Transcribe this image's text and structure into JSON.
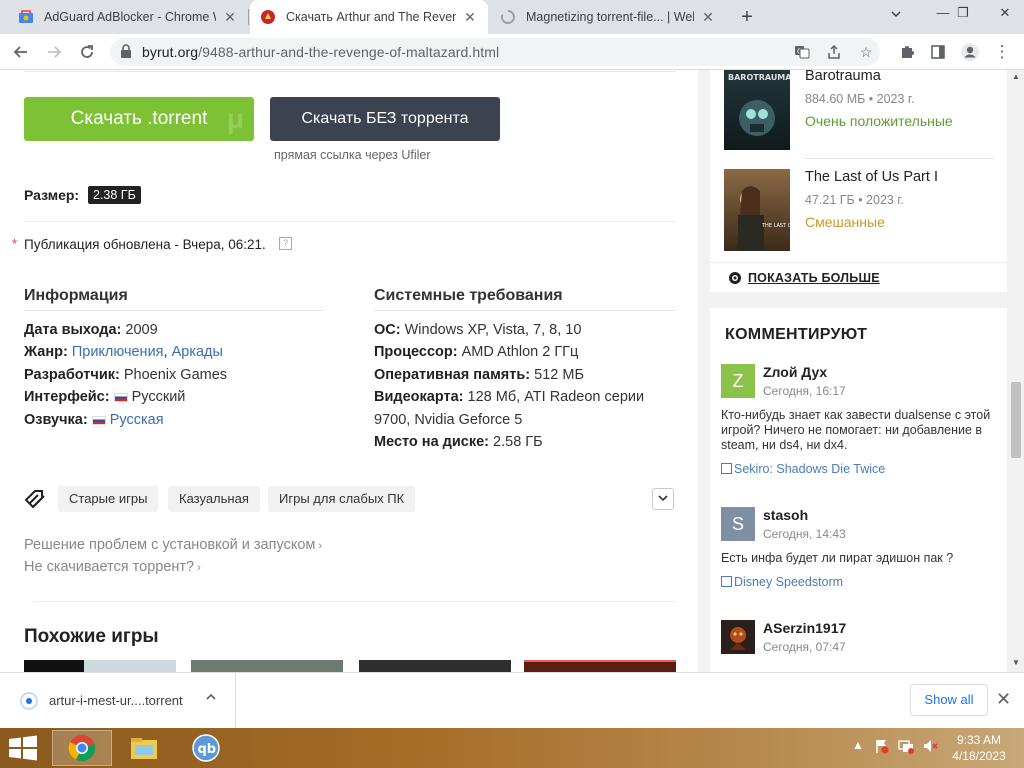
{
  "browser": {
    "tabs": [
      {
        "title": "AdGuard AdBlocker - Chrome Web Store",
        "active": false
      },
      {
        "title": "Скачать Arthur and The Revenge of Maltazard",
        "active": true
      },
      {
        "title": "Magnetizing torrent-file... | Webtor",
        "active": false
      }
    ],
    "url_host": "byrut.org",
    "url_path": "/9488-arthur-and-the-revenge-of-maltazard.html"
  },
  "page": {
    "download_torrent_label": "Скачать .torrent",
    "download_direct_label": "Скачать БЕЗ торрента",
    "direct_note": "прямая ссылка через Ufiler",
    "size_label": "Размер:",
    "size_value": "2.38 ГБ",
    "updated_text": "Публикация обновлена - Вчера, 06:21.",
    "info": {
      "title": "Информация",
      "release_label": "Дата выхода:",
      "release_value": "2009",
      "genre_label": "Жанр:",
      "genre_1": "Приключения",
      "genre_sep": ",",
      "genre_2": "Аркады",
      "dev_label": "Разработчик:",
      "dev_value": "Phoenix Games",
      "ui_label": "Интерфейс:",
      "ui_value": "Русский",
      "voice_label": "Озвучка:",
      "voice_value": "Русская"
    },
    "sysreq": {
      "title": "Системные требования",
      "os_label": "ОС:",
      "os_value": "Windows XP, Vista, 7, 8, 10",
      "cpu_label": "Процессор:",
      "cpu_value": "AMD Athlon 2 ГГц",
      "ram_label": "Оперативная память:",
      "ram_value": "512 МБ",
      "gpu_label": "Видеокарта:",
      "gpu_value_1": "128 Мб, ATI Radeon серии",
      "gpu_value_2": "9700, Nvidia Geforce 5",
      "disk_label": "Место на диске:",
      "disk_value": "2.58 ГБ"
    },
    "tags": [
      "Старые игры",
      "Казуальная",
      "Игры для слабых ПК"
    ],
    "help_links": [
      "Решение проблем с установкой и запуском",
      "Не скачивается торрент?"
    ],
    "similar_title": "Похожие игры"
  },
  "sidebar": {
    "games": [
      {
        "title": "Barotrauma",
        "meta": "884.60 МБ • 2023 г.",
        "rating": "Очень положительные",
        "rating_color": "#5a9e2f"
      },
      {
        "title": "The Last of Us Part I",
        "meta": "47.21 ГБ • 2023 г.",
        "rating": "Смешанные",
        "rating_color": "#c59a2b"
      }
    ],
    "show_more": "ПОКАЗАТЬ БОЛЬШЕ",
    "comments_title": "КОММЕНТИРУЮТ",
    "comments": [
      {
        "avatar": "Z",
        "avatar_color": "#8bc34a",
        "author": "Zлой Дух",
        "time": "Сегодня, 16:17",
        "text": "Кто-нибудь знает как завести dualsense с этой игрой? Ничего не помогает: ни добавление в steam, ни ds4, ни dx4.",
        "game": "Sekiro: Shadows Die Twice"
      },
      {
        "avatar": "S",
        "avatar_color": "#7f8fa6",
        "author": "stasoh",
        "time": "Сегодня, 14:43",
        "text": "Есть инфа будет ли пират эдишон пак ?",
        "game": "Disney Speedstorm"
      },
      {
        "avatar": "",
        "avatar_color": "#2b1f1a",
        "author": "ASerzin1917",
        "time": "Сегодня, 07:47",
        "text": "",
        "game": ""
      }
    ]
  },
  "downloads": {
    "file": "artur-i-mest-ur....torrent",
    "show_all": "Show all"
  },
  "taskbar": {
    "time": "9:33 AM",
    "date": "4/18/2023"
  }
}
